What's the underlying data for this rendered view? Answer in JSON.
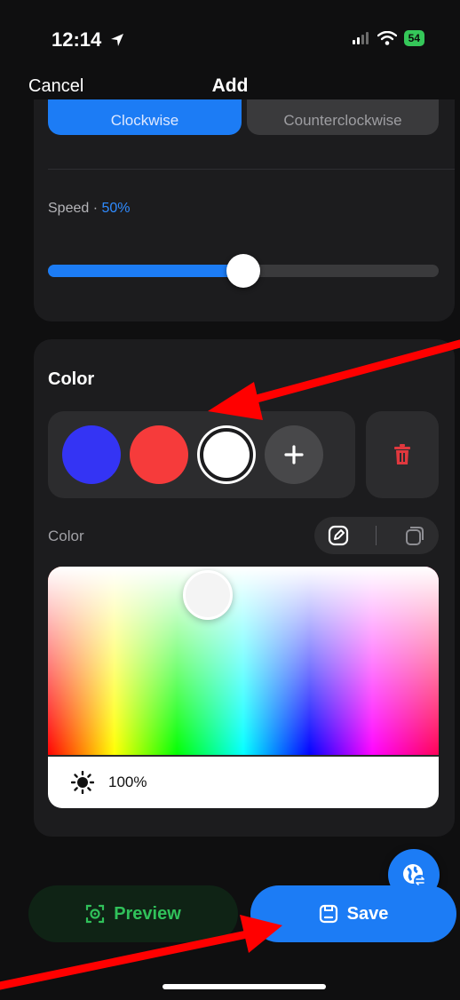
{
  "status_bar": {
    "time": "12:14",
    "battery": "54"
  },
  "nav": {
    "cancel_label": "Cancel",
    "title": "Add"
  },
  "direction": {
    "clockwise_label": "Clockwise",
    "counterclockwise_label": "Counterclockwise",
    "selected": "Clockwise"
  },
  "speed": {
    "label": "Speed · ",
    "value_text": "50%",
    "value_fraction": 0.5
  },
  "color_section": {
    "title": "Color",
    "swatches": [
      {
        "color": "#3434f4"
      },
      {
        "color": "#f63b3b"
      },
      {
        "color": "#ffffff",
        "selected": true
      }
    ],
    "add_icon": "plus-icon",
    "delete_icon": "trash-icon",
    "sub_label": "Color",
    "mode_icons": [
      "edit-icon",
      "copy-icon"
    ],
    "brightness_text": "100%",
    "brightness_icon": "sun-icon"
  },
  "actions": {
    "preview_label": "Preview",
    "save_label": "Save",
    "fab_icon": "globe-swap-icon"
  },
  "colors": {
    "accent": "#1c7cf5",
    "preview_green": "#30c15a",
    "annotation_arrow": "#ff0000"
  }
}
